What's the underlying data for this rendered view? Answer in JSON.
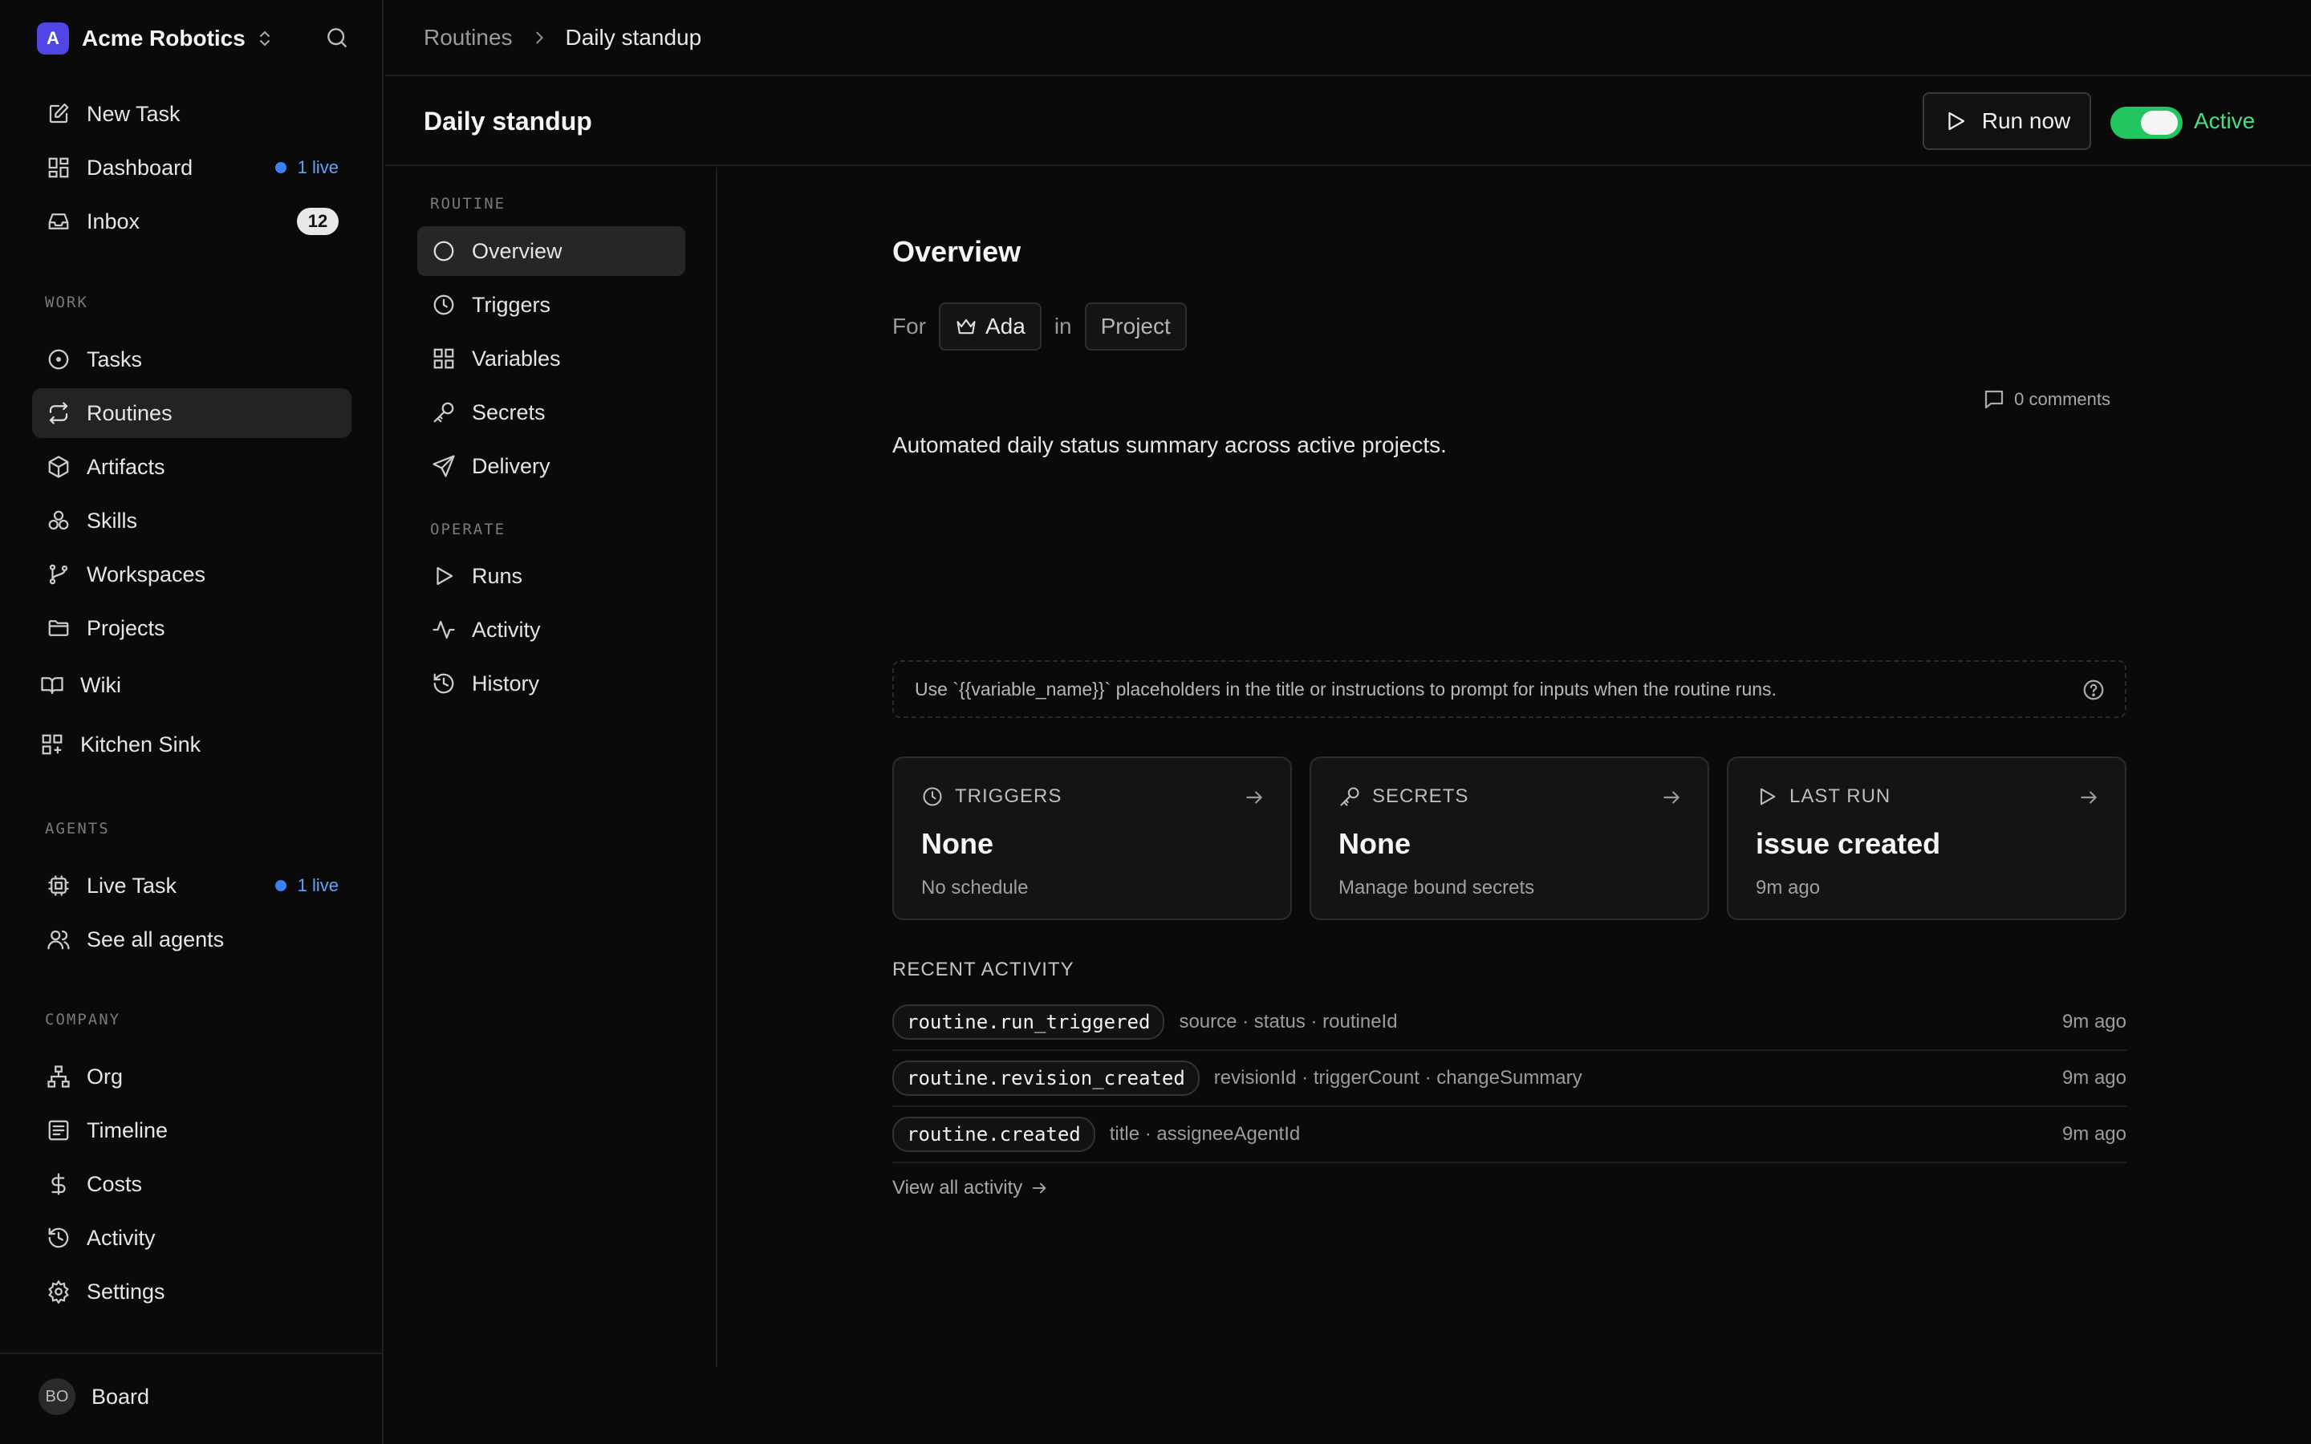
{
  "workspace": {
    "logo_letter": "A",
    "name": "Acme Robotics"
  },
  "sidebar": {
    "top_items": [
      {
        "label": "New Task",
        "icon": "pencil-square-icon"
      },
      {
        "label": "Dashboard",
        "icon": "dashboard-icon",
        "live": "1 live"
      },
      {
        "label": "Inbox",
        "icon": "inbox-icon",
        "badge": "12"
      }
    ],
    "work_label": "WORK",
    "work_items": [
      {
        "label": "Tasks",
        "icon": "target-circle-icon"
      },
      {
        "label": "Routines",
        "icon": "repeat-icon",
        "active": true
      },
      {
        "label": "Artifacts",
        "icon": "box-icon"
      },
      {
        "label": "Skills",
        "icon": "skills-icon"
      },
      {
        "label": "Workspaces",
        "icon": "git-branch-icon"
      },
      {
        "label": "Projects",
        "icon": "folder-icon"
      }
    ],
    "extra_items": [
      {
        "label": "Wiki",
        "icon": "book-icon"
      },
      {
        "label": "Kitchen Sink",
        "icon": "grid-plus-icon"
      }
    ],
    "agents_label": "AGENTS",
    "agent_items": [
      {
        "label": "Live Task",
        "icon": "cpu-icon",
        "live": "1 live"
      },
      {
        "label": "See all agents",
        "icon": "users-icon"
      }
    ],
    "company_label": "COMPANY",
    "company_items": [
      {
        "label": "Org",
        "icon": "org-chart-icon"
      },
      {
        "label": "Timeline",
        "icon": "list-doc-icon"
      },
      {
        "label": "Costs",
        "icon": "dollar-icon"
      },
      {
        "label": "Activity",
        "icon": "history-icon"
      },
      {
        "label": "Settings",
        "icon": "gear-icon"
      }
    ],
    "footer": {
      "avatar": "BO",
      "name": "Board"
    }
  },
  "breadcrumb": {
    "parent": "Routines",
    "current": "Daily standup"
  },
  "header": {
    "title": "Daily standup",
    "run_label": "Run now",
    "status_label": "Active"
  },
  "subnav": {
    "routine_label": "ROUTINE",
    "routine_items": [
      {
        "label": "Overview",
        "icon": "circle-icon",
        "active": true
      },
      {
        "label": "Triggers",
        "icon": "clock-icon"
      },
      {
        "label": "Variables",
        "icon": "grid-icon"
      },
      {
        "label": "Secrets",
        "icon": "key-icon"
      },
      {
        "label": "Delivery",
        "icon": "send-icon"
      }
    ],
    "operate_label": "OPERATE",
    "operate_items": [
      {
        "label": "Runs",
        "icon": "play-icon"
      },
      {
        "label": "Activity",
        "icon": "pulse-icon"
      },
      {
        "label": "History",
        "icon": "history-icon"
      }
    ]
  },
  "overview": {
    "title": "Overview",
    "for_label": "For",
    "assignee": "Ada",
    "in_label": "in",
    "project": "Project",
    "comments": "0 comments",
    "description": "Automated daily status summary across active projects.",
    "hint": "Use `{{variable_name}}` placeholders in the title or instructions to prompt for inputs when the routine runs."
  },
  "cards": [
    {
      "label": "TRIGGERS",
      "icon": "clock-icon",
      "value": "None",
      "sub": "No schedule"
    },
    {
      "label": "SECRETS",
      "icon": "key-icon",
      "value": "None",
      "sub": "Manage bound secrets"
    },
    {
      "label": "LAST RUN",
      "icon": "play-icon",
      "value": "issue created",
      "sub": "9m ago"
    }
  ],
  "recent_activity": {
    "title": "RECENT ACTIVITY",
    "rows": [
      {
        "event": "routine.run_triggered",
        "fields": "source · status · routineId",
        "time": "9m ago"
      },
      {
        "event": "routine.revision_created",
        "fields": "revisionId · triggerCount · changeSummary",
        "time": "9m ago"
      },
      {
        "event": "routine.created",
        "fields": "title · assigneeAgentId",
        "time": "9m ago"
      }
    ],
    "view_all": "View all activity"
  },
  "colors": {
    "accent_green": "#22c55e",
    "live_blue": "#3b82f6",
    "logo": "#4f46e5"
  }
}
